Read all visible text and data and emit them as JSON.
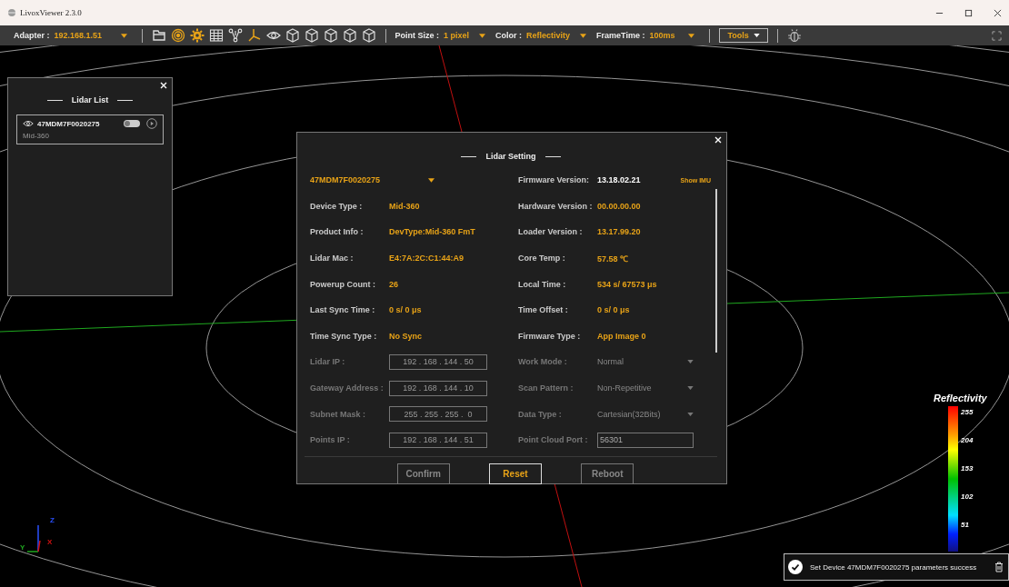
{
  "window": {
    "title": "LivoxViewer 2.3.0"
  },
  "toolbar": {
    "adapter": {
      "label": "Adapter :",
      "value": "192.168.1.51"
    },
    "tool_buttons": [
      {
        "kind": "folder",
        "on": false
      },
      {
        "kind": "radar",
        "on": true
      },
      {
        "kind": "gear",
        "on": true
      },
      {
        "kind": "table",
        "on": false
      },
      {
        "kind": "graph",
        "on": false
      },
      {
        "kind": "axes",
        "on": true
      },
      {
        "kind": "eye",
        "on": false
      },
      {
        "kind": "cube",
        "on": false
      },
      {
        "kind": "cube",
        "on": false
      },
      {
        "kind": "cube",
        "on": false
      },
      {
        "kind": "cube",
        "on": false
      },
      {
        "kind": "cube",
        "on": false
      }
    ],
    "point_size": {
      "label": "Point Size :",
      "value": "1 pixel"
    },
    "color": {
      "label": "Color :",
      "value": "Reflectivity"
    },
    "frame_time": {
      "label": "FrameTime :",
      "value": "100ms"
    },
    "tools": "Tools"
  },
  "lidar_list": {
    "title": "Lidar List",
    "devices": [
      {
        "id": "47MDM7F0020275",
        "model": "Mid-360",
        "on": false
      }
    ]
  },
  "dialog": {
    "title": "Lidar Setting",
    "device_select": "47MDM7F0020275",
    "firmware": {
      "label": "Firmware Version:",
      "value": "13.18.02.21"
    },
    "show_imu": "Show IMU",
    "rows": [
      {
        "left": {
          "kind": "text",
          "label": "Device Type :",
          "value": "Mid-360",
          "disabled": false
        },
        "right": {
          "kind": "text",
          "label": "Hardware Version :",
          "value": "00.00.00.00",
          "disabled": false
        }
      },
      {
        "left": {
          "kind": "text",
          "label": "Product Info :",
          "value": "DevType:Mid-360 FmT",
          "disabled": false
        },
        "right": {
          "kind": "text",
          "label": "Loader Version :",
          "value": "13.17.99.20",
          "disabled": false
        }
      },
      {
        "left": {
          "kind": "text",
          "label": "Lidar Mac :",
          "value": "E4:7A:2C:C1:44:A9",
          "disabled": false
        },
        "right": {
          "kind": "text",
          "label": "Core Temp :",
          "value": "57.58 ℃",
          "disabled": false
        }
      },
      {
        "left": {
          "kind": "text",
          "label": "Powerup Count :",
          "value": "26",
          "disabled": false
        },
        "right": {
          "kind": "text",
          "label": "Local Time :",
          "value": "534 s/ 67573 μs",
          "disabled": false
        }
      },
      {
        "left": {
          "kind": "text",
          "label": "Last Sync Time :",
          "value": "0 s/ 0 μs",
          "disabled": false
        },
        "right": {
          "kind": "text",
          "label": "Time Offset :",
          "value": "0 s/ 0 μs",
          "disabled": false
        }
      },
      {
        "left": {
          "kind": "text",
          "label": "Time Sync Type :",
          "value": "No Sync",
          "disabled": false
        },
        "right": {
          "kind": "text",
          "label": "Firmware Type :",
          "value": "App Image 0",
          "disabled": false
        }
      },
      {
        "left": {
          "kind": "ip",
          "label": "Lidar IP :",
          "value": "192 . 168 . 144 . 50",
          "disabled": true
        },
        "right": {
          "kind": "select",
          "label": "Work Mode :",
          "value": "Normal",
          "disabled": true
        }
      },
      {
        "left": {
          "kind": "ip",
          "label": "Gateway Address :",
          "value": "192 . 168 . 144 . 10",
          "disabled": true
        },
        "right": {
          "kind": "select",
          "label": "Scan Pattern :",
          "value": "Non-Repetitive",
          "disabled": true
        }
      },
      {
        "left": {
          "kind": "ip",
          "label": "Subnet Mask :",
          "value": "255 . 255 . 255 .  0",
          "disabled": true
        },
        "right": {
          "kind": "select",
          "label": "Data Type :",
          "value": "Cartesian(32Bits)",
          "disabled": true
        }
      },
      {
        "left": {
          "kind": "ip",
          "label": "Points IP :",
          "value": "192 . 168 . 144 . 51",
          "disabled": true
        },
        "right": {
          "kind": "spin",
          "label": "Point Cloud Port :",
          "value": "56301",
          "disabled": true
        }
      }
    ],
    "buttons": [
      {
        "label": "Confirm",
        "focused": false
      },
      {
        "label": "Reset",
        "focused": true
      },
      {
        "label": "Reboot",
        "focused": false
      }
    ]
  },
  "legend": {
    "title": "Reflectivity",
    "ticks": [
      "255",
      "204",
      "153",
      "102",
      "51"
    ]
  },
  "axes": {
    "z": "Z",
    "y": "Y",
    "x": "X"
  },
  "toast": {
    "message": "Set Device 47MDM7F0020275 parameters success"
  }
}
